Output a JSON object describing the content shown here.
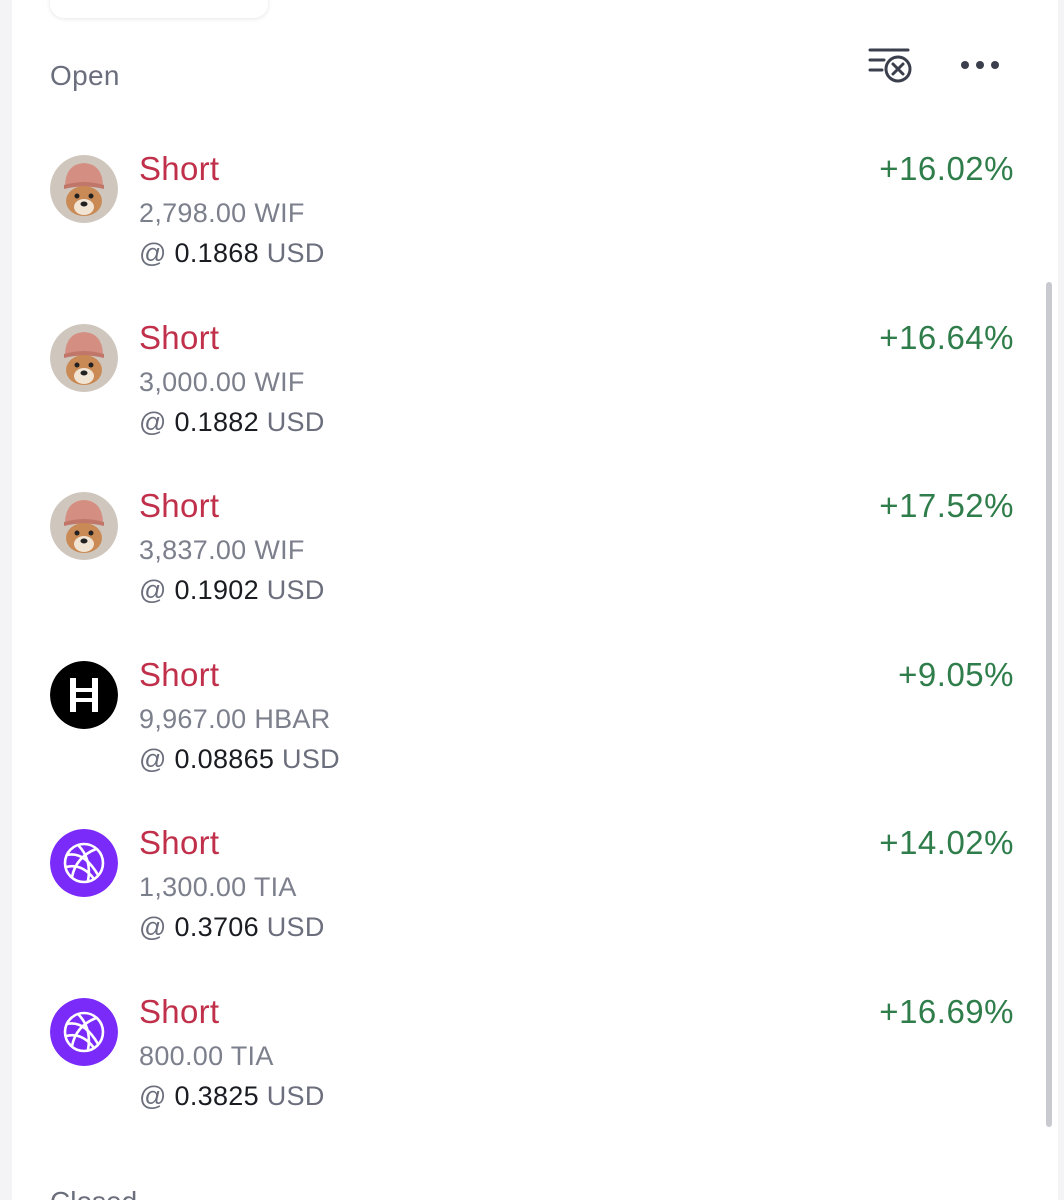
{
  "section": {
    "title": "Open",
    "closed_title": "Closed"
  },
  "header_icons": {
    "clear": "clear-list-icon",
    "more": "more-horizontal-icon"
  },
  "colors": {
    "short": "#c0304a",
    "pnl_positive": "#2f7d4a"
  },
  "orders": [
    {
      "side": "Short",
      "amount": "2,798.00",
      "asset": "WIF",
      "at": "@",
      "price": "0.1868",
      "quote": "USD",
      "pnl": "+16.02%",
      "icon": "wif-dog-icon"
    },
    {
      "side": "Short",
      "amount": "3,000.00",
      "asset": "WIF",
      "at": "@",
      "price": "0.1882",
      "quote": "USD",
      "pnl": "+16.64%",
      "icon": "wif-dog-icon"
    },
    {
      "side": "Short",
      "amount": "3,837.00",
      "asset": "WIF",
      "at": "@",
      "price": "0.1902",
      "quote": "USD",
      "pnl": "+17.52%",
      "icon": "wif-dog-icon"
    },
    {
      "side": "Short",
      "amount": "9,967.00",
      "asset": "HBAR",
      "at": "@",
      "price": "0.08865",
      "quote": "USD",
      "pnl": "+9.05%",
      "icon": "hbar-icon"
    },
    {
      "side": "Short",
      "amount": "1,300.00",
      "asset": "TIA",
      "at": "@",
      "price": "0.3706",
      "quote": "USD",
      "pnl": "+14.02%",
      "icon": "tia-icon"
    },
    {
      "side": "Short",
      "amount": "800.00",
      "asset": "TIA",
      "at": "@",
      "price": "0.3825",
      "quote": "USD",
      "pnl": "+16.69%",
      "icon": "tia-icon"
    }
  ]
}
